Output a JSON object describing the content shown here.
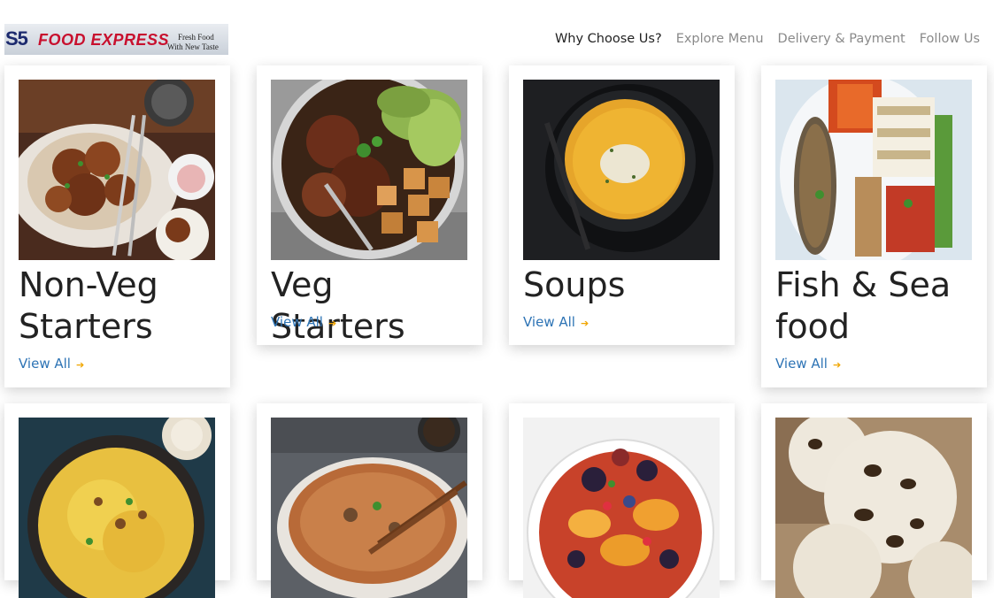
{
  "header": {
    "logo_s5": "S5",
    "logo_name": "FOOD EXPRESS",
    "logo_tagline_1": "Fresh Food",
    "logo_tagline_2": "With New Taste",
    "nav": [
      "Why Choose Us?",
      "Explore Menu",
      "Delivery & Payment",
      "Follow Us"
    ]
  },
  "categories": [
    {
      "title": "Non-Veg Starters",
      "link": "View All",
      "image": "fried-chicken-image"
    },
    {
      "title": "Veg Starters",
      "link": "View All",
      "image": "tofu-bowl-image"
    },
    {
      "title": "Soups",
      "link": "View All",
      "image": "pumpkin-soup-image"
    },
    {
      "title": "Fish & Sea food",
      "link": "View All",
      "image": "grilled-fish-platter-image"
    },
    {
      "image": "biryani-image"
    },
    {
      "image": "noodles-bowl-image"
    },
    {
      "image": "fruit-salad-image"
    },
    {
      "image": "ice-cream-image"
    }
  ],
  "icons": {
    "link_arrow": "arrow-right-icon"
  },
  "colors": {
    "link": "#2e74b5",
    "arrow": "#f0a500",
    "logo_red": "#c8102e",
    "logo_blue": "#1c2a6e"
  }
}
